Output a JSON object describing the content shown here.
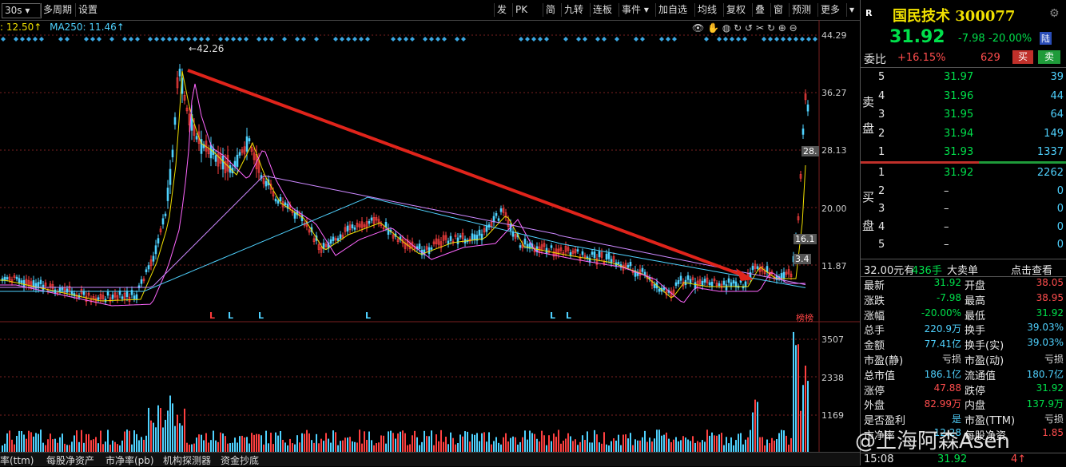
{
  "toolbar": {
    "period": "30s",
    "multi_period": "多周期",
    "settings": "设置",
    "right_buttons": [
      "发",
      "PK",
      "简",
      "九转",
      "连板",
      "事件",
      "加自选",
      "均线",
      "复权",
      "叠",
      "窗",
      "预测",
      "更多"
    ]
  },
  "ma_legend": {
    "ma_a": ": 12.50↑",
    "ma250": "MA250: 11.46↑"
  },
  "chart_data": {
    "type": "candlestick",
    "price_ticks": [
      "44.29",
      "36.27",
      "28.13",
      "20.00",
      "11.87"
    ],
    "volume_ticks": [
      "3507",
      "2338",
      "1169"
    ],
    "annotations": {
      "high_label": "42.26",
      "right_labels": [
        "28.",
        "16.1",
        "3.4"
      ],
      "markers": [
        "L",
        "L",
        "L",
        "L",
        "L",
        "L"
      ],
      "marker_red": "L",
      "rank_label": "榜榜"
    },
    "trend_arrow": {
      "from": [
        235,
        88
      ],
      "to": [
        943,
        350
      ],
      "color": "#e0241b"
    },
    "price_ylim": [
      8.0,
      44.29
    ],
    "volume_ylim": [
      0,
      3507
    ]
  },
  "bottom_tabs": [
    "率(ttm)",
    "每股净资产",
    "市净率(pb)",
    "机构探测器",
    "资金抄底"
  ],
  "quote": {
    "name": "国民技术 300077",
    "price": "31.92",
    "change": "-7.98",
    "change_pct": "-20.00%",
    "badge": "陆",
    "wei_bi_label": "委比",
    "wei_bi": "+16.15%",
    "wei_cha": "629",
    "buy_btn": "买",
    "sell_btn": "卖",
    "sell_label_1": "卖",
    "sell_label_2": "盘",
    "buy_label_1": "买",
    "buy_label_2": "盘",
    "asks": [
      {
        "lvl": "5",
        "price": "31.97",
        "vol": "39"
      },
      {
        "lvl": "4",
        "price": "31.96",
        "vol": "44"
      },
      {
        "lvl": "3",
        "price": "31.95",
        "vol": "64"
      },
      {
        "lvl": "2",
        "price": "31.94",
        "vol": "149"
      },
      {
        "lvl": "1",
        "price": "31.93",
        "vol": "1337"
      }
    ],
    "bids": [
      {
        "lvl": "1",
        "price": "31.92",
        "vol": "2262"
      },
      {
        "lvl": "2",
        "price": "–",
        "vol": "0"
      },
      {
        "lvl": "3",
        "price": "–",
        "vol": "0"
      },
      {
        "lvl": "4",
        "price": "–",
        "vol": "0"
      },
      {
        "lvl": "5",
        "price": "–",
        "vol": "0"
      }
    ],
    "big_order": {
      "price": "32.00元有",
      "vol": "436手",
      "text": "大卖单",
      "link": "点击查看"
    },
    "stats": [
      {
        "l": "最新",
        "v": "31.92",
        "l2": "开盘",
        "v2": "38.05"
      },
      {
        "l": "涨跌",
        "v": "-7.98",
        "l2": "最高",
        "v2": "38.95"
      },
      {
        "l": "涨幅",
        "v": "-20.00%",
        "l2": "最低",
        "v2": "31.92"
      },
      {
        "l": "总手",
        "v": "220.9万",
        "l2": "换手",
        "v2": "39.03%"
      },
      {
        "l": "金额",
        "v": "77.41亿",
        "l2": "换手(实)",
        "v2": "39.03%"
      },
      {
        "l": "市盈(静)",
        "v": "亏损",
        "l2": "市盈(动)",
        "v2": "亏损"
      },
      {
        "l": "总市值",
        "v": "186.1亿",
        "l2": "流通值",
        "v2": "180.7亿"
      },
      {
        "l": "涨停",
        "v": "47.88",
        "l2": "跌停",
        "v2": "31.92"
      },
      {
        "l": "外盘",
        "v": "82.99万",
        "l2": "内盘",
        "v2": "137.9万"
      },
      {
        "l": "是否盈利",
        "v": "是",
        "l2": "市盈(TTM)",
        "v2": "亏损"
      },
      {
        "l": "市净率",
        "v": "12.28",
        "l2": "每股净资",
        "v2": "1.85"
      }
    ],
    "time": "15:08",
    "last_price": "31.92",
    "last_vol": "4"
  },
  "watermark": "@上海阿森Asen"
}
